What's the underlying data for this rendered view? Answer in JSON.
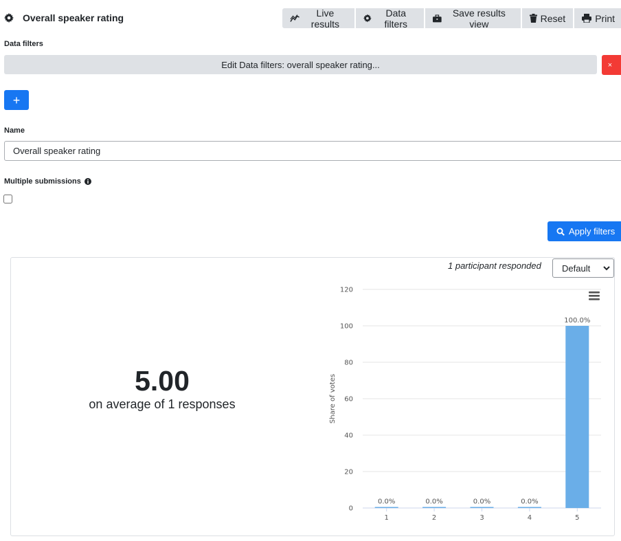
{
  "header": {
    "title": "Overall speaker rating",
    "toolbar": [
      {
        "label": "Live results",
        "icon": "chart-line-icon"
      },
      {
        "label": "Data filters",
        "icon": "gear-icon"
      },
      {
        "label": "Save results view",
        "icon": "briefcase-icon"
      },
      {
        "label": "Reset",
        "icon": "trash-icon"
      },
      {
        "label": "Print",
        "icon": "printer-icon"
      }
    ]
  },
  "filters": {
    "label": "Data filters",
    "edit_label": "Edit Data filters: overall speaker rating...",
    "remove_label": "×",
    "add_label": "+"
  },
  "name_field": {
    "label": "Name",
    "value": "Overall speaker rating"
  },
  "multiple_submissions": {
    "label": "Multiple submissions",
    "checked": false
  },
  "apply_button": {
    "label": "Apply filters"
  },
  "results": {
    "responded_text": "1 participant responded",
    "view_select": {
      "selected": "Default"
    },
    "average_value": "5.00",
    "average_caption": "on average of 1 responses"
  },
  "colors": {
    "primary": "#1777f2",
    "danger": "#f33a35",
    "bar": "#6aaee8",
    "button_gray": "#dee1e5"
  },
  "chart_data": {
    "type": "bar",
    "categories": [
      "1",
      "2",
      "3",
      "4",
      "5"
    ],
    "values": [
      0,
      0,
      0,
      0,
      100
    ],
    "data_labels": [
      "0.0%",
      "0.0%",
      "0.0%",
      "0.0%",
      "100.0%"
    ],
    "ylabel": "Share of votes",
    "xlabel": "",
    "ylim": [
      0,
      120
    ],
    "yticks": [
      0,
      20,
      40,
      60,
      80,
      100,
      120
    ],
    "grid": true
  }
}
